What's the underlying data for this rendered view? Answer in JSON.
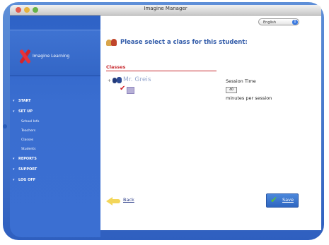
{
  "window": {
    "title": "Imagine Manager"
  },
  "brand": {
    "logo_text": "Imagine Learning"
  },
  "sidebar": {
    "items": [
      {
        "label": "START",
        "sub": false
      },
      {
        "label": "SET UP",
        "sub": false
      },
      {
        "label": "School Info",
        "sub": true
      },
      {
        "label": "Teachers",
        "sub": true
      },
      {
        "label": "Classes",
        "sub": true
      },
      {
        "label": "Students",
        "sub": true
      },
      {
        "label": "REPORTS",
        "sub": false
      },
      {
        "label": "SUPPORT",
        "sub": false
      },
      {
        "label": "LOG OFF",
        "sub": false
      }
    ]
  },
  "language": {
    "selected": "English"
  },
  "main": {
    "heading": "Please select a class for this student:",
    "classes_label": "Classes",
    "tree": {
      "expander": "+",
      "teacher": "Mr. Greis",
      "class_checked": true
    },
    "session": {
      "title": "Session Time",
      "minutes": "40",
      "unit_label": "minutes per session"
    }
  },
  "footer": {
    "back_label": "Back",
    "save_label": "Save"
  },
  "colors": {
    "frame": "#2f5fbf",
    "sidebar": "#3a6ed0",
    "accent_red": "#c7282e",
    "heading_blue": "#2f59a8",
    "save_green": "#58c23a"
  }
}
